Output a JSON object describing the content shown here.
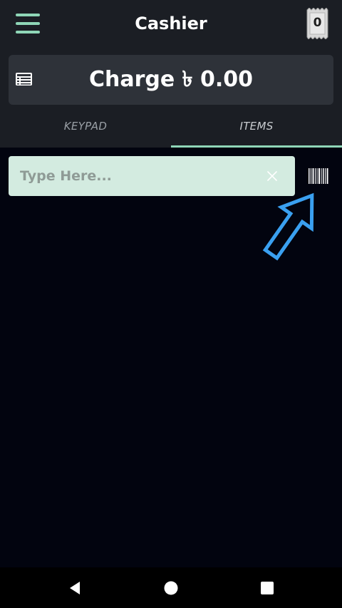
{
  "header": {
    "title": "Cashier",
    "receipt_count": "0",
    "menu_icon": "hamburger-menu-icon",
    "receipt_icon": "receipt-icon"
  },
  "charge": {
    "label": "Charge ৳ 0.00",
    "icon": "list-icon"
  },
  "tabs": [
    {
      "label": "KEYPAD",
      "selected": false
    },
    {
      "label": "ITEMS",
      "selected": true
    }
  ],
  "search": {
    "value": "",
    "placeholder": "Type Here...",
    "clear_icon": "close-icon",
    "barcode_icon": "barcode-icon"
  },
  "colors": {
    "accent": "#8fd6b7",
    "appbar": "#1b1e24",
    "charge_button": "#2e3239",
    "search_bg": "#d3ebe0",
    "background": "#02040f",
    "annotation_arrow": "#3aa0f0"
  },
  "navigation_bar": {
    "icons": [
      "back-icon",
      "home-icon",
      "recent-apps-icon"
    ]
  }
}
